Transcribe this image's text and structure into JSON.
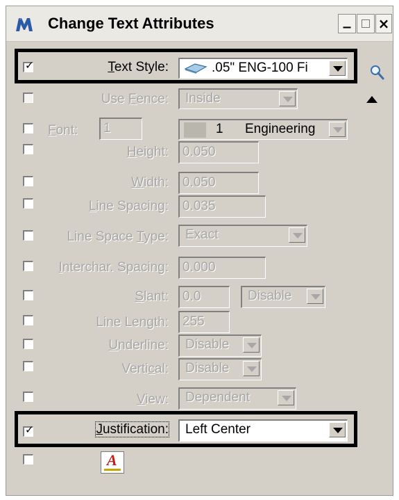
{
  "window": {
    "title": "Change Text Attributes"
  },
  "controls": {
    "min_glyph": "_",
    "close_glyph": "×"
  },
  "icons": {
    "app": "microstation-icon",
    "search": "magnifier-icon",
    "up": "triangle-up-icon",
    "text_style": "text-style-icon",
    "font": "font-icon",
    "text_attr": "text-attributes-icon"
  },
  "colors": {
    "window_bg": "#d4d0c8",
    "title_bar": "#ebe9e4",
    "highlight_border": "#000000",
    "disabled_text": "#a7a7a7",
    "app_icon": "#2b5aa8"
  },
  "check_glyph": "✓",
  "text_style": {
    "label_u": "T",
    "label_rest": "ext Style:",
    "value": ".05\"  ENG-100 Fi",
    "checked": true
  },
  "use_fence": {
    "label_pre": "Use ",
    "label_u": "F",
    "label_rest": "ence:",
    "value": "Inside",
    "checked": false
  },
  "font": {
    "label_u": "F",
    "label_rest": "ont:",
    "number": "1",
    "face_number": "1",
    "face_name": "Engineering",
    "checked": false
  },
  "height": {
    "label_u": "H",
    "label_rest": "eight:",
    "value": "0.050",
    "checked": false
  },
  "width": {
    "label_u": "W",
    "label_rest": "idth:",
    "value": "0.050",
    "checked": false
  },
  "line_spacing": {
    "label_u": "L",
    "label_rest": "ine Spacing:",
    "value": "0.035",
    "checked": false
  },
  "line_space_type": {
    "label_pre": "Line Space ",
    "label_u": "T",
    "label_rest": "ype:",
    "value": "Exact",
    "checked": false
  },
  "interchar_spacing": {
    "label_u": "I",
    "label_rest": "nterchar. Spacing:",
    "value": "0.000",
    "checked": false
  },
  "slant": {
    "label_u": "S",
    "label_rest": "lant:",
    "value": "0.0",
    "mode": "Disable",
    "checked": false
  },
  "line_length": {
    "label": "Line Length:",
    "value": "255",
    "checked": false
  },
  "underline": {
    "label_u": "U",
    "label_rest": "nderline:",
    "value": "Disable",
    "checked": false
  },
  "vertical": {
    "label_pre": "Verti",
    "label_u": "c",
    "label_rest": "al:",
    "value": "Disable",
    "checked": false
  },
  "view": {
    "label_u": "V",
    "label_rest": "iew:",
    "value": "Dependent",
    "checked": false
  },
  "justification": {
    "label_u": "J",
    "label_rest": "ustification:",
    "value": "Left Center",
    "checked": true
  },
  "text_attributes_icon": {
    "glyph": "A",
    "checked": false
  }
}
